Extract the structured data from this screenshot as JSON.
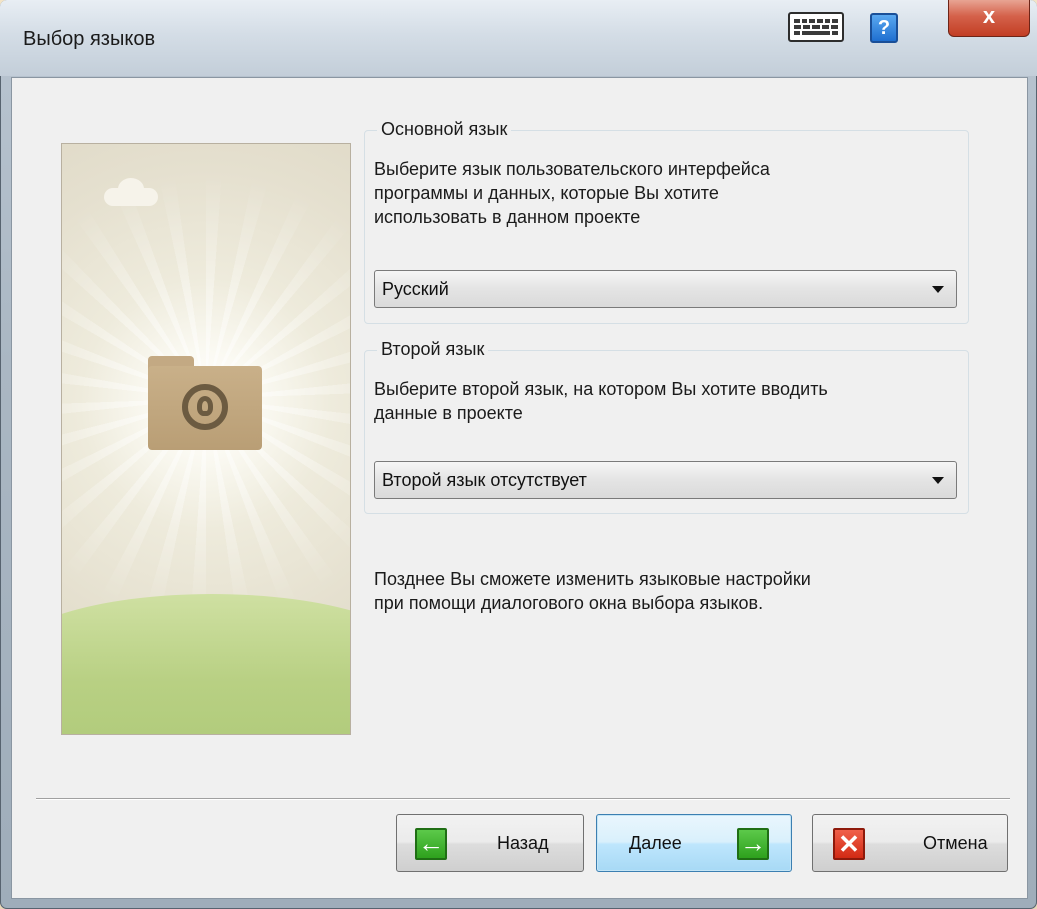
{
  "window": {
    "title": "Выбор языков",
    "help_label": "?",
    "close_label": "x"
  },
  "primary_group": {
    "legend": "Основной язык",
    "description_lines": [
      "Выберите язык пользовательского интерфейса",
      "программы и данных, которые Вы хотите",
      "использовать в данном проекте"
    ],
    "selected": "Русский"
  },
  "secondary_group": {
    "legend": "Второй язык",
    "description_lines": [
      "Выберите второй язык, на котором Вы хотите вводить",
      "данные в проекте"
    ],
    "selected": "Второй язык отсутствует"
  },
  "note_lines": [
    "Позднее Вы сможете изменить языковые настройки",
    "при помощи диалогового окна выбора языков."
  ],
  "buttons": {
    "back": {
      "label": "Назад",
      "icon": "arrow-left-icon"
    },
    "next": {
      "label": "Далее",
      "icon": "arrow-right-icon"
    },
    "cancel": {
      "label": "Отмена",
      "icon": "cross-icon"
    }
  },
  "colors": {
    "icon_green": "#2ea11d",
    "icon_red": "#d22a14",
    "close_red": "#c23e24",
    "help_blue": "#1f6fd0",
    "default_button_border": "#3c7fb1"
  }
}
